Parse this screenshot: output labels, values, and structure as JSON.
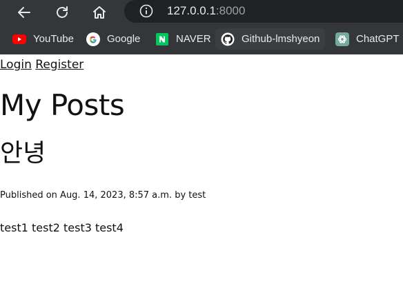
{
  "browser": {
    "url": {
      "host": "127.0.0.1",
      "port": ":8000"
    },
    "icons": {
      "back": "back-arrow-icon",
      "reload": "reload-icon",
      "home": "home-icon",
      "site_info": "info-icon"
    },
    "bookmarks": [
      {
        "label": "YouTube",
        "icon": "youtube-icon"
      },
      {
        "label": "Google",
        "icon": "google-icon"
      },
      {
        "label": "NAVER",
        "icon": "naver-icon"
      },
      {
        "label": "Github-lmshyeon",
        "icon": "github-icon"
      },
      {
        "label": "ChatGPT",
        "icon": "chatgpt-icon"
      }
    ],
    "colors": {
      "toolbar_bg": "#35363a",
      "omnibox_bg": "#202124",
      "text": "#e8eaed"
    }
  },
  "page": {
    "nav": {
      "login": "Login",
      "register": "Register"
    },
    "title": "My Posts",
    "posts": [
      {
        "title": "안녕",
        "meta": "Published on Aug. 14, 2023, 8:57 a.m. by test",
        "body": "test1 test2 test3 test4"
      }
    ]
  }
}
